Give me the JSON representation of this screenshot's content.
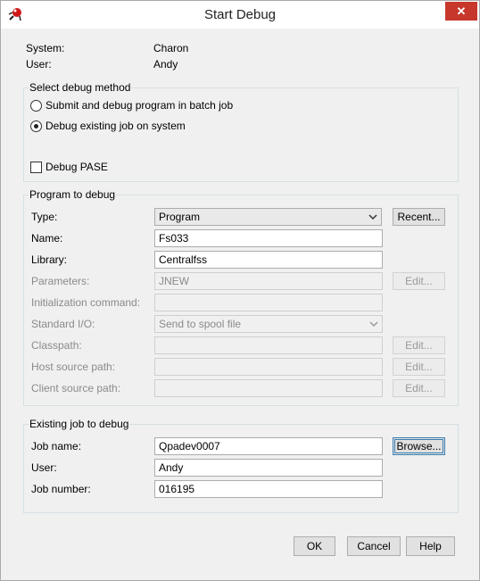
{
  "window": {
    "title": "Start Debug",
    "close_glyph": "✕"
  },
  "info": {
    "system_label": "System:",
    "system_value": "Charon",
    "user_label": "User:",
    "user_value": "Andy"
  },
  "debug_method": {
    "title": "Select debug method",
    "options": [
      {
        "label": "Submit and debug program in batch job",
        "selected": false
      },
      {
        "label": "Debug existing job on system",
        "selected": true
      }
    ],
    "pase_label": "Debug PASE",
    "pase_checked": false
  },
  "program": {
    "title": "Program to debug",
    "type_label": "Type:",
    "type_value": "Program",
    "recent_button": "Recent...",
    "name_label": "Name:",
    "name_value": "Fs033",
    "library_label": "Library:",
    "library_value": "Centralfss",
    "parameters_label": "Parameters:",
    "parameters_value": "JNEW",
    "init_label": "Initialization command:",
    "init_value": "",
    "stdio_label": "Standard I/O:",
    "stdio_value": "Send to spool file",
    "classpath_label": "Classpath:",
    "classpath_value": "",
    "host_label": "Host source path:",
    "host_value": "",
    "client_label": "Client source path:",
    "client_value": "",
    "edit_button": "Edit..."
  },
  "job": {
    "title": "Existing job to debug",
    "jobname_label": "Job name:",
    "jobname_value": "Qpadev0007",
    "browse_button": "Browse...",
    "user_label": "User:",
    "user_value": "Andy",
    "number_label": "Job number:",
    "number_value": "016195"
  },
  "buttons": {
    "ok": "OK",
    "cancel": "Cancel",
    "help": "Help"
  },
  "colors": {
    "close_red": "#c7372c",
    "focus_blue": "#3c7fb1",
    "group_border": "#d5dfe5"
  },
  "icons": {
    "app": "bug-icon",
    "close": "close-icon",
    "dropdown": "chevron-down-icon"
  }
}
